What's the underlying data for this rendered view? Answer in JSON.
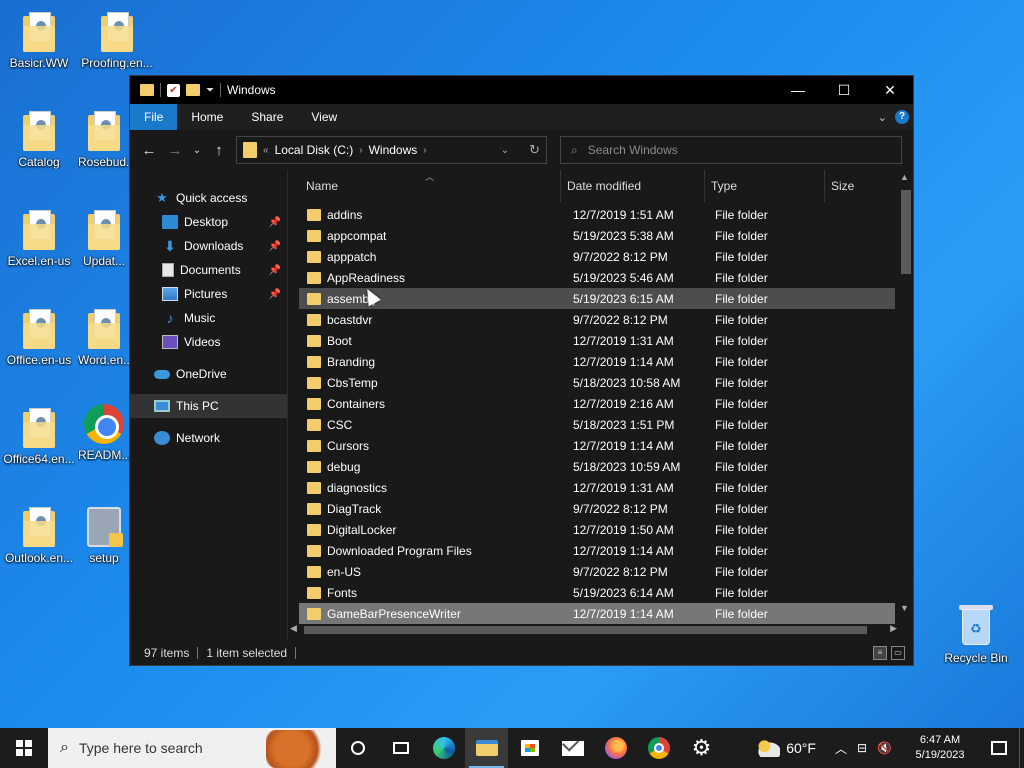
{
  "desktop": {
    "icons": [
      {
        "label": "Basicr.WW"
      },
      {
        "label": "Proofing.en..."
      },
      {
        "label": "Catalog"
      },
      {
        "label": "Rosebud..."
      },
      {
        "label": "Excel.en-us"
      },
      {
        "label": "Updat..."
      },
      {
        "label": "Office.en-us"
      },
      {
        "label": "Word.en..."
      },
      {
        "label": "Office64.en..."
      },
      {
        "label": "READM..."
      },
      {
        "label": "Outlook.en..."
      },
      {
        "label": "setup"
      },
      {
        "label": "Recycle Bin"
      }
    ]
  },
  "window": {
    "title": "Windows",
    "controls": {
      "minimize": "—",
      "maximize": "☐",
      "close": "✕"
    },
    "ribbon": {
      "tabs": [
        "File",
        "Home",
        "Share",
        "View"
      ],
      "help": "?"
    },
    "address": {
      "parts": [
        "Local Disk (C:)",
        "Windows"
      ],
      "prefix": "«"
    },
    "search": {
      "placeholder": "Search Windows"
    },
    "nav_pane": {
      "items": [
        {
          "label": "Quick access"
        },
        {
          "label": "Desktop"
        },
        {
          "label": "Downloads"
        },
        {
          "label": "Documents"
        },
        {
          "label": "Pictures"
        },
        {
          "label": "Music"
        },
        {
          "label": "Videos"
        },
        {
          "label": "OneDrive"
        },
        {
          "label": "This PC"
        },
        {
          "label": "Network"
        }
      ]
    },
    "columns": {
      "name": "Name",
      "date": "Date modified",
      "type": "Type",
      "size": "Size"
    },
    "files": [
      {
        "name": "addins",
        "date": "12/7/2019 1:51 AM",
        "type": "File folder"
      },
      {
        "name": "appcompat",
        "date": "5/19/2023 5:38 AM",
        "type": "File folder"
      },
      {
        "name": "apppatch",
        "date": "9/7/2022 8:12 PM",
        "type": "File folder"
      },
      {
        "name": "AppReadiness",
        "date": "5/19/2023 5:46 AM",
        "type": "File folder"
      },
      {
        "name": "assembly",
        "date": "5/19/2023 6:15 AM",
        "type": "File folder"
      },
      {
        "name": "bcastdvr",
        "date": "9/7/2022 8:12 PM",
        "type": "File folder"
      },
      {
        "name": "Boot",
        "date": "12/7/2019 1:31 AM",
        "type": "File folder"
      },
      {
        "name": "Branding",
        "date": "12/7/2019 1:14 AM",
        "type": "File folder"
      },
      {
        "name": "CbsTemp",
        "date": "5/18/2023 10:58 AM",
        "type": "File folder"
      },
      {
        "name": "Containers",
        "date": "12/7/2019 2:16 AM",
        "type": "File folder"
      },
      {
        "name": "CSC",
        "date": "5/18/2023 1:51 PM",
        "type": "File folder"
      },
      {
        "name": "Cursors",
        "date": "12/7/2019 1:14 AM",
        "type": "File folder"
      },
      {
        "name": "debug",
        "date": "5/18/2023 10:59 AM",
        "type": "File folder"
      },
      {
        "name": "diagnostics",
        "date": "12/7/2019 1:31 AM",
        "type": "File folder"
      },
      {
        "name": "DiagTrack",
        "date": "9/7/2022 8:12 PM",
        "type": "File folder"
      },
      {
        "name": "DigitalLocker",
        "date": "12/7/2019 1:50 AM",
        "type": "File folder"
      },
      {
        "name": "Downloaded Program Files",
        "date": "12/7/2019 1:14 AM",
        "type": "File folder"
      },
      {
        "name": "en-US",
        "date": "9/7/2022 8:12 PM",
        "type": "File folder"
      },
      {
        "name": "Fonts",
        "date": "5/19/2023 6:14 AM",
        "type": "File folder"
      },
      {
        "name": "GameBarPresenceWriter",
        "date": "12/7/2019 1:14 AM",
        "type": "File folder"
      }
    ],
    "status": {
      "items": "97 items",
      "selected": "1 item selected"
    }
  },
  "taskbar": {
    "search_placeholder": "Type here to search",
    "temperature": "60°F",
    "time": "6:47 AM",
    "date": "5/19/2023"
  }
}
